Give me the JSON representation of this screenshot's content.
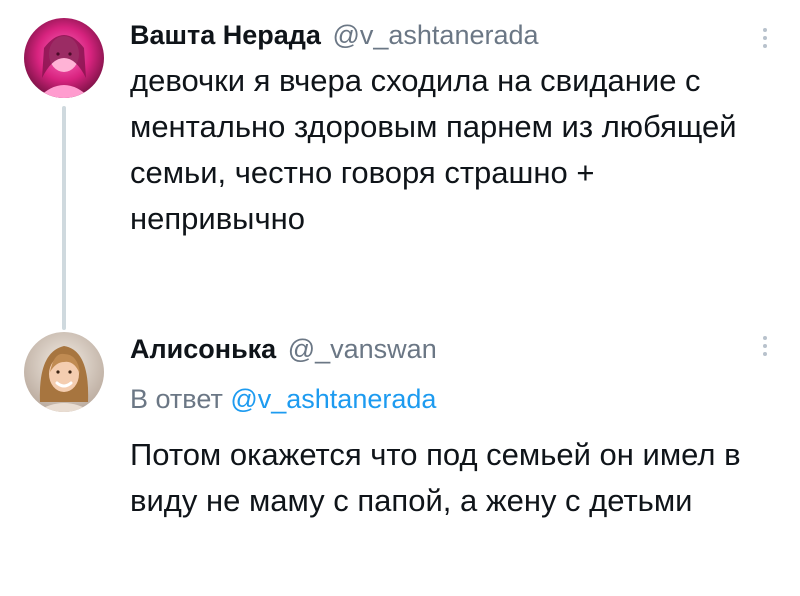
{
  "tweets": [
    {
      "author": {
        "display_name": "Вашта Нерада",
        "handle": "@v_ashtanerada"
      },
      "text": "девочки я вчера сходила на свидание с ментально здоровым парнем из любящей семьи, честно говоря страшно + непривычно",
      "more_icon": "more-vertical-icon"
    },
    {
      "author": {
        "display_name": "Алисонька",
        "handle": "@_vanswan"
      },
      "reply_prefix": "В ответ",
      "reply_to": "@v_ashtanerada",
      "text": "Потом окажется что под семьей он имел в виду не маму с папой, а жену с детьми",
      "more_icon": "more-vertical-icon"
    }
  ],
  "colors": {
    "text_primary": "#0f1419",
    "text_secondary": "#6b7785",
    "link": "#1d9bf0",
    "thread_line": "#cfd9de"
  }
}
